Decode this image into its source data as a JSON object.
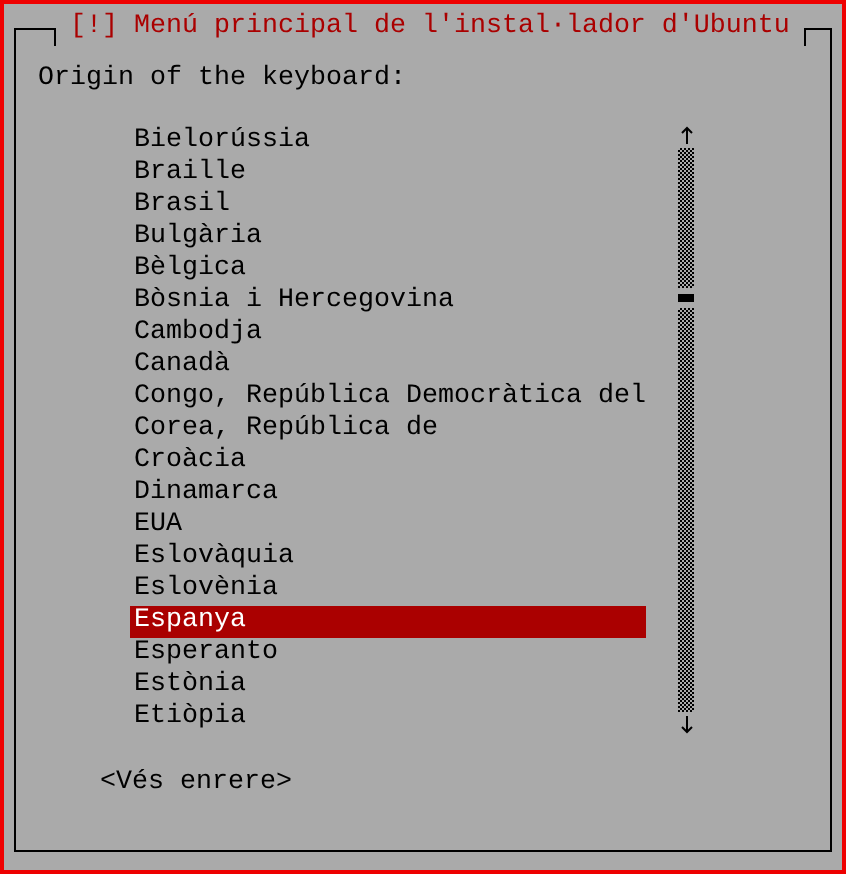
{
  "window": {
    "title": "[!] Menú principal de l'instal·lador d'Ubuntu"
  },
  "prompt": "Origin of the keyboard:",
  "items": [
    {
      "label": "Bielorússia",
      "selected": false
    },
    {
      "label": "Braille",
      "selected": false
    },
    {
      "label": "Brasil",
      "selected": false
    },
    {
      "label": "Bulgària",
      "selected": false
    },
    {
      "label": "Bèlgica",
      "selected": false
    },
    {
      "label": "Bòsnia i Hercegovina",
      "selected": false
    },
    {
      "label": "Cambodja",
      "selected": false
    },
    {
      "label": "Canadà",
      "selected": false
    },
    {
      "label": "Congo, República Democràtica del",
      "selected": false
    },
    {
      "label": "Corea, República de",
      "selected": false
    },
    {
      "label": "Croàcia",
      "selected": false
    },
    {
      "label": "Dinamarca",
      "selected": false
    },
    {
      "label": "EUA",
      "selected": false
    },
    {
      "label": "Eslovàquia",
      "selected": false
    },
    {
      "label": "Eslovènia",
      "selected": false
    },
    {
      "label": "Espanya",
      "selected": true
    },
    {
      "label": "Esperanto",
      "selected": false
    },
    {
      "label": "Estònia",
      "selected": false
    },
    {
      "label": "Etiòpia",
      "selected": false
    }
  ],
  "buttons": [
    {
      "label": "<Vés enrere>"
    }
  ]
}
